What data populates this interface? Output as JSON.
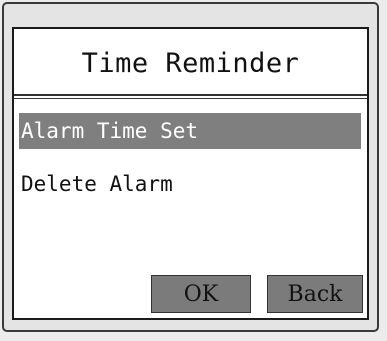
{
  "title": "Time Reminder",
  "menu": {
    "items": [
      {
        "label": "Alarm Time Set",
        "selected": true
      },
      {
        "label": "Delete Alarm",
        "selected": false
      }
    ]
  },
  "buttons": {
    "ok_label": "OK",
    "back_label": "Back"
  },
  "colors": {
    "selected_bg": "#7f7f7f",
    "button_bg": "#7b7b7b",
    "frame": "#e4e4e4"
  }
}
